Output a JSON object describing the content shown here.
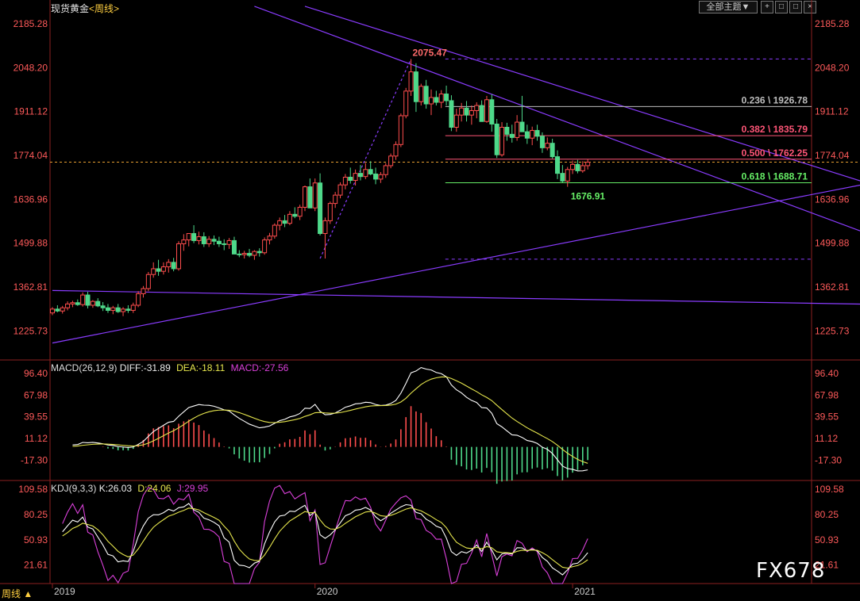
{
  "header": {
    "instrument": "现货黄金",
    "timeframe": "<周线>",
    "theme_button": "全部主题▼",
    "controls": [
      "+",
      "□",
      "□",
      "×"
    ]
  },
  "colors": {
    "up": "#ff4d4d",
    "down": "#4ed98a",
    "trendline": "#8a3cff",
    "axis_text": "#ff5a5a",
    "grid": "#7a1f1f",
    "diff": "#ffffff",
    "dea": "#e6e64d",
    "j_line": "#d940d9"
  },
  "chart_data": {
    "type": "candlestick",
    "title": "现货黄金 <周线>",
    "ylim": [
      1140,
      2210
    ],
    "y_ticks": [
      "2185.28",
      "2048.20",
      "1911.12",
      "1774.04",
      "1636.96",
      "1499.88",
      "1362.81",
      "1225.73"
    ],
    "x_labels": [
      "2019",
      "2020",
      "2021"
    ],
    "last_price": 1753,
    "annotations": {
      "high": "2075.47",
      "low": "1676.91"
    },
    "fib_levels": [
      {
        "ratio": "0.236",
        "price": 1926.78,
        "label": "0.236 \\ 1926.78",
        "color": "#bdbdbd"
      },
      {
        "ratio": "0.382",
        "price": 1835.79,
        "label": "0.382 \\ 1835.79",
        "color": "#ff5577"
      },
      {
        "ratio": "0.500",
        "price": 1762.25,
        "label": "0.500 \\ 1762.25",
        "color": "#ff5577"
      },
      {
        "ratio": "0.618",
        "price": 1688.71,
        "label": "0.618 \\ 1688.71",
        "color": "#66ee66"
      }
    ],
    "fib_bounds": [
      2075.47,
      1450
    ],
    "ohlc": [
      [
        1282,
        1300,
        1275,
        1294
      ],
      [
        1294,
        1306,
        1284,
        1288
      ],
      [
        1288,
        1304,
        1280,
        1298
      ],
      [
        1298,
        1318,
        1290,
        1310
      ],
      [
        1310,
        1320,
        1300,
        1314
      ],
      [
        1314,
        1324,
        1304,
        1308
      ],
      [
        1308,
        1346,
        1302,
        1338
      ],
      [
        1338,
        1348,
        1296,
        1306
      ],
      [
        1306,
        1322,
        1298,
        1318
      ],
      [
        1318,
        1328,
        1300,
        1304
      ],
      [
        1304,
        1316,
        1288,
        1298
      ],
      [
        1298,
        1310,
        1282,
        1290
      ],
      [
        1290,
        1304,
        1278,
        1298
      ],
      [
        1298,
        1310,
        1282,
        1286
      ],
      [
        1286,
        1300,
        1272,
        1294
      ],
      [
        1294,
        1306,
        1282,
        1290
      ],
      [
        1290,
        1314,
        1282,
        1306
      ],
      [
        1306,
        1350,
        1300,
        1342
      ],
      [
        1342,
        1366,
        1330,
        1358
      ],
      [
        1358,
        1410,
        1350,
        1402
      ],
      [
        1402,
        1440,
        1392,
        1420
      ],
      [
        1420,
        1448,
        1398,
        1412
      ],
      [
        1412,
        1440,
        1402,
        1426
      ],
      [
        1426,
        1450,
        1408,
        1440
      ],
      [
        1440,
        1454,
        1412,
        1420
      ],
      [
        1420,
        1506,
        1414,
        1498
      ],
      [
        1498,
        1528,
        1476,
        1510
      ],
      [
        1510,
        1526,
        1490,
        1530
      ],
      [
        1530,
        1556,
        1500,
        1508
      ],
      [
        1508,
        1536,
        1496,
        1520
      ],
      [
        1520,
        1534,
        1488,
        1498
      ],
      [
        1498,
        1522,
        1488,
        1512
      ],
      [
        1512,
        1524,
        1494,
        1506
      ],
      [
        1506,
        1520,
        1488,
        1498
      ],
      [
        1498,
        1512,
        1478,
        1496
      ],
      [
        1496,
        1516,
        1482,
        1508
      ],
      [
        1508,
        1520,
        1482,
        1466
      ],
      [
        1466,
        1478,
        1456,
        1464
      ],
      [
        1464,
        1476,
        1452,
        1468
      ],
      [
        1468,
        1482,
        1456,
        1462
      ],
      [
        1462,
        1478,
        1448,
        1474
      ],
      [
        1474,
        1484,
        1458,
        1470
      ],
      [
        1470,
        1518,
        1464,
        1510
      ],
      [
        1510,
        1532,
        1496,
        1522
      ],
      [
        1522,
        1562,
        1514,
        1556
      ],
      [
        1556,
        1580,
        1540,
        1570
      ],
      [
        1570,
        1588,
        1550,
        1562
      ],
      [
        1562,
        1600,
        1556,
        1590
      ],
      [
        1590,
        1612,
        1578,
        1584
      ],
      [
        1584,
        1620,
        1572,
        1612
      ],
      [
        1612,
        1680,
        1600,
        1676
      ],
      [
        1676,
        1702,
        1640,
        1610
      ],
      [
        1610,
        1702,
        1600,
        1688
      ],
      [
        1688,
        1718,
        1524,
        1530
      ],
      [
        1530,
        1580,
        1452,
        1570
      ],
      [
        1570,
        1630,
        1560,
        1624
      ],
      [
        1624,
        1660,
        1610,
        1650
      ],
      [
        1650,
        1690,
        1640,
        1682
      ],
      [
        1682,
        1716,
        1668,
        1706
      ],
      [
        1706,
        1736,
        1686,
        1696
      ],
      [
        1696,
        1730,
        1680,
        1718
      ],
      [
        1718,
        1744,
        1696,
        1708
      ],
      [
        1708,
        1750,
        1700,
        1730
      ],
      [
        1730,
        1756,
        1712,
        1716
      ],
      [
        1716,
        1736,
        1684,
        1700
      ],
      [
        1700,
        1722,
        1688,
        1714
      ],
      [
        1714,
        1750,
        1704,
        1742
      ],
      [
        1742,
        1780,
        1734,
        1772
      ],
      [
        1772,
        1818,
        1760,
        1808
      ],
      [
        1808,
        1905,
        1800,
        1898
      ],
      [
        1898,
        1985,
        1890,
        1975
      ],
      [
        1975,
        2075,
        1960,
        2035
      ],
      [
        2035,
        2062,
        1910,
        1942
      ],
      [
        1942,
        1998,
        1930,
        1990
      ],
      [
        1990,
        2010,
        1920,
        1935
      ],
      [
        1935,
        1980,
        1900,
        1955
      ],
      [
        1955,
        1976,
        1930,
        1940
      ],
      [
        1940,
        1978,
        1922,
        1966
      ],
      [
        1966,
        1992,
        1930,
        1945
      ],
      [
        1945,
        1962,
        1850,
        1862
      ],
      [
        1862,
        1920,
        1848,
        1900
      ],
      [
        1900,
        1938,
        1880,
        1922
      ],
      [
        1922,
        1944,
        1880,
        1900
      ],
      [
        1900,
        1930,
        1870,
        1914
      ],
      [
        1914,
        1940,
        1890,
        1930
      ],
      [
        1930,
        1946,
        1880,
        1880
      ],
      [
        1880,
        1960,
        1876,
        1948
      ],
      [
        1948,
        1965,
        1848,
        1872
      ],
      [
        1872,
        1888,
        1766,
        1776
      ],
      [
        1776,
        1878,
        1770,
        1862
      ],
      [
        1862,
        1876,
        1820,
        1840
      ],
      [
        1840,
        1870,
        1814,
        1830
      ],
      [
        1830,
        1900,
        1820,
        1878
      ],
      [
        1878,
        1960,
        1866,
        1848
      ],
      [
        1848,
        1870,
        1810,
        1828
      ],
      [
        1828,
        1864,
        1806,
        1852
      ],
      [
        1852,
        1870,
        1820,
        1834
      ],
      [
        1834,
        1846,
        1782,
        1798
      ],
      [
        1798,
        1830,
        1790,
        1812
      ],
      [
        1812,
        1826,
        1764,
        1770
      ],
      [
        1770,
        1790,
        1700,
        1718
      ],
      [
        1718,
        1744,
        1690,
        1694
      ],
      [
        1694,
        1738,
        1676,
        1730
      ],
      [
        1730,
        1758,
        1716,
        1746
      ],
      [
        1746,
        1760,
        1718,
        1726
      ],
      [
        1726,
        1756,
        1720,
        1742
      ],
      [
        1742,
        1762,
        1730,
        1753
      ]
    ],
    "trendlines": [
      {
        "from": [
          0,
          1352
        ],
        "to": [
          200,
          1299
        ]
      },
      {
        "from": [
          0,
          1188
        ],
        "to": [
          200,
          1805
        ],
        "note": "rising support through 2019 and 2020 lows"
      },
      {
        "from": [
          53,
          1452
        ],
        "to": [
          71,
          2075
        ],
        "dashed": true
      },
      {
        "from": [
          50,
          2240
        ],
        "to": [
          200,
          1496
        ]
      },
      {
        "from": [
          40,
          2240
        ],
        "to": [
          200,
          1304
        ]
      }
    ],
    "macd": {
      "label": "MACD(26,12,9)",
      "diff_label": "DIFF:-31.89",
      "dea_label": "DEA:-18.11",
      "macd_label": "MACD:-27.56",
      "ylim": [
        -42,
        112
      ],
      "y_ticks": [
        "96.40",
        "67.98",
        "39.55",
        "11.12",
        "-17.30"
      ]
    },
    "kdj": {
      "label": "KDJ(9,3,3)",
      "k_label": "K:26.03",
      "d_label": "D:24.06",
      "j_label": "J:29.95",
      "ylim": [
        0,
        118
      ],
      "y_ticks": [
        "109.58",
        "80.25",
        "50.93",
        "21.61"
      ]
    }
  },
  "footer": {
    "timeframe_tab": "周线 ▲",
    "watermark": "FX678"
  }
}
